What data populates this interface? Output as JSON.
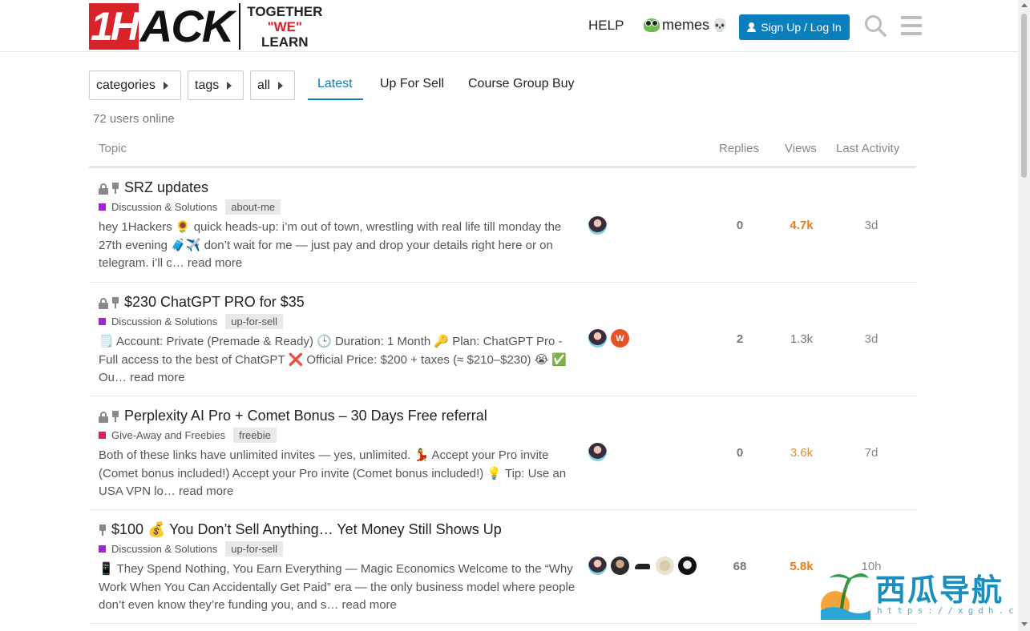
{
  "header": {
    "logo_1h": "1H",
    "logo_ack": "ACK",
    "logo_tag_line1": "TOGETHER",
    "logo_tag_line2": "\"WE\"",
    "logo_tag_line3": "LEARN",
    "help": "HELP",
    "memes": "memes",
    "signup": "Sign Up / Log In"
  },
  "filters": {
    "categories": "categories",
    "tags": "tags",
    "all": "all"
  },
  "tabs": [
    {
      "label": "Latest",
      "active": true
    },
    {
      "label": "Up For Sell",
      "active": false
    },
    {
      "label": "Course Group Buy",
      "active": false
    }
  ],
  "online": "72 users online",
  "columns": {
    "topic": "Topic",
    "replies": "Replies",
    "views": "Views",
    "activity": "Last Activity"
  },
  "colors": {
    "accent": "#0a7fbe",
    "cat_discussion": "#a61ee0",
    "cat_giveaway": "#e8186d",
    "hot_views": "#e87b1d"
  },
  "topics": [
    {
      "title": "SRZ updates",
      "locked": true,
      "pinned": true,
      "category": "Discussion & Solutions",
      "tag": "about-me",
      "excerpt": "hey 1Hackers 🌻 quick heads-up: i’m out of town, wrestling with real life till monday the 27th evening 🧳✈️ don’t wait for me — just pay and drop your details right here or on telegram. i’ll c… read more",
      "replies": "0",
      "views": "4.7k",
      "activity": "3d"
    },
    {
      "title": "$230 ChatGPT PRO for $35",
      "locked": true,
      "pinned": true,
      "category": "Discussion & Solutions",
      "tag": "up-for-sell",
      "excerpt": "🗒️ Account: Private (Premade & Ready) 🕒 Duration: 1 Month 🔑 Plan: ChatGPT Pro - Full access to the best of ChatGPT ❌ Official Price: $200 + taxes (≈ $210–$230) 😭 ✅ Ou… read more",
      "replies": "2",
      "views": "1.3k",
      "activity": "3d",
      "avatar_w": "W"
    },
    {
      "title": "Perplexity AI Pro + Comet Bonus – 30 Days Free referral",
      "locked": true,
      "pinned": true,
      "category": "Give-Away and Freebies",
      "tag": "freebie",
      "excerpt": "Both of these links have unlimited invites — yes, unlimited. 💃 Accept your Pro invite (Comet bonus included!) Accept your Pro invite (Comet bonus included!) 💡 Tip: Use an USA VPN lo… read more",
      "replies": "0",
      "views": "3.6k",
      "activity": "7d"
    },
    {
      "title": "$100 💰 You Don’t Sell Anything… Yet Money Still Shows Up",
      "locked": false,
      "pinned": true,
      "category": "Discussion & Solutions",
      "tag": "up-for-sell",
      "excerpt": "📱 They Spend Nothing, You Earn Everything — Magic Economics Welcome to the “Why Work When You Can Accidentally Get Paid” era — the only business model where people don’t even know they’re funding you, and s… read more",
      "replies": "68",
      "views": "5.8k",
      "activity": "10h"
    }
  ],
  "watermark": {
    "text": "西瓜导航",
    "url": "https://xgdh.cn"
  }
}
